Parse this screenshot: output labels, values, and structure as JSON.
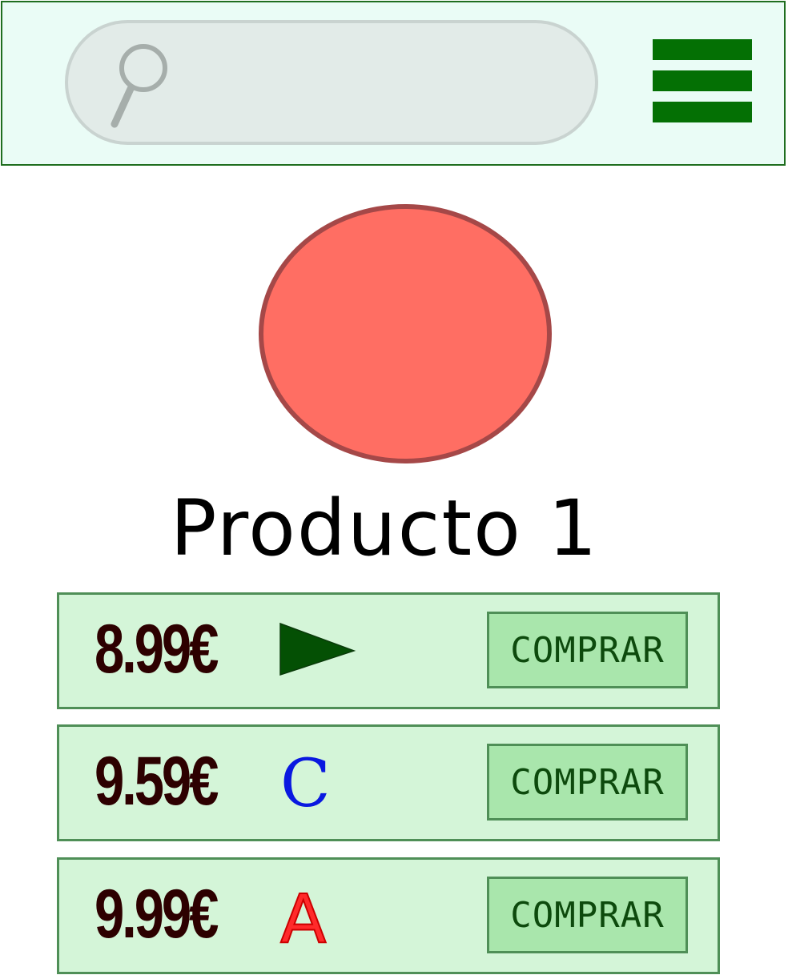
{
  "header": {
    "search": {
      "placeholder": "",
      "icon": "search-icon"
    },
    "menu": {
      "icon": "hamburger-menu-icon"
    }
  },
  "product": {
    "image_icon": "product-circle",
    "title": "Producto 1"
  },
  "offers": [
    {
      "price": "8.99€",
      "badge_icon": "play-arrow-icon",
      "badge_text": "",
      "buy_label": "COMPRAR"
    },
    {
      "price": "9.59€",
      "badge_icon": "letter-c-icon",
      "badge_text": "C",
      "buy_label": "COMPRAR"
    },
    {
      "price": "9.99€",
      "badge_icon": "letter-a-icon",
      "badge_text": "A",
      "buy_label": "COMPRAR"
    }
  ],
  "colors": {
    "header_bg": "#eafcf6",
    "header_border": "#1f6e1f",
    "menu_icon": "#047004",
    "product_fill": "#ff6e63",
    "product_stroke": "#a54848",
    "row_bg": "#d4f5d8",
    "row_border": "#4f8f57",
    "button_bg": "#a9e6ac",
    "button_text": "#0d4a0d",
    "price_text": "#2d0000",
    "badge_arrow": "#045004",
    "badge_c": "#0a18e0",
    "badge_a": "#ff2a2a"
  }
}
